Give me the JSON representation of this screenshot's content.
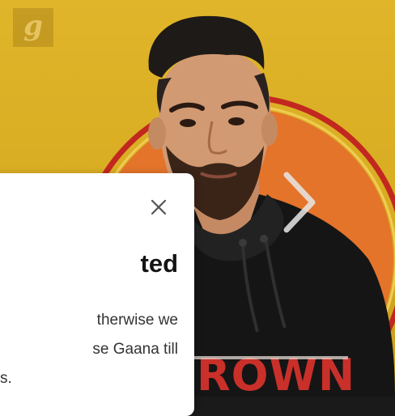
{
  "brand": {
    "logo_letter": "g"
  },
  "banner": {
    "print_text": "ROWN"
  },
  "carousel": {
    "next_icon": "chevron-right-icon"
  },
  "modal": {
    "close_icon": "close-icon",
    "title": "ted",
    "body_lines": [
      "therwise we",
      "se Gaana till",
      "s."
    ]
  },
  "colors": {
    "background_yellow": "#dcb025",
    "ring_red": "#c2281f",
    "circle_orange": "#e4742a",
    "hoodie": "#151515",
    "print_red": "#c9302a",
    "modal_bg": "#ffffff",
    "title_text": "#141414",
    "body_text": "#333333"
  }
}
